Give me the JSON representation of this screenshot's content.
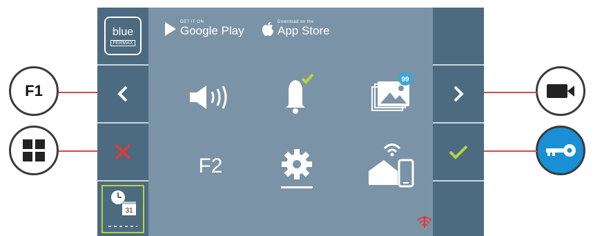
{
  "brand": {
    "logo_text": "blue",
    "sub_text": "FERMAX"
  },
  "stores": {
    "google_small": "GET IT ON",
    "google_big": "Google Play",
    "apple_small": "Download on the",
    "apple_big": "App Store"
  },
  "gallery_badge": "99",
  "f2_label": "F2",
  "f1_label": "F1",
  "calendar_day": "31",
  "icons": {
    "prev": "chevron-left-icon",
    "next": "chevron-right-icon",
    "cancel": "close-icon",
    "confirm": "check-icon",
    "volume": "speaker-icon",
    "bell": "bell-icon",
    "gallery": "gallery-icon",
    "settings": "gear-icon",
    "home_wifi": "home-wifi-icon",
    "camera": "camera-icon",
    "key": "key-icon",
    "grid": "grid-icon",
    "wifi_status": "wifi-status-icon"
  },
  "colors": {
    "panel": "#4c6a80",
    "screen": "#7b93a6",
    "accent_green": "#b5d63b",
    "cancel_red": "#e03a3a",
    "key_blue": "#1a8fd6",
    "badge_blue": "#3aa6e0"
  }
}
